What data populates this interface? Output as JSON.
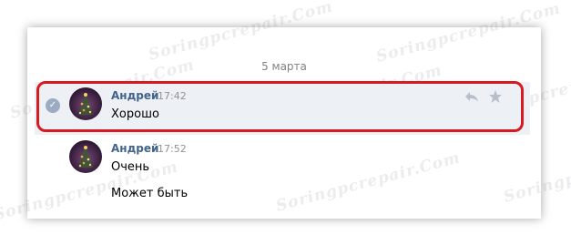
{
  "watermark": {
    "text": "Soringpcrepair.Com"
  },
  "conversation": {
    "date_separator": "5 марта",
    "messages": [
      {
        "author": "Андрей",
        "time": "17:42",
        "lines": [
          "Хорошо"
        ],
        "selected": true
      },
      {
        "author": "Андрей",
        "time": "17:52",
        "lines": [
          "Очень",
          "Может быть"
        ],
        "selected": false
      }
    ]
  },
  "icons": {
    "selected_check": "check-icon",
    "reply": "reply-icon",
    "important": "star-icon"
  },
  "colors": {
    "author_name": "#42648b",
    "selected_background": "#edf0f5",
    "highlight_frame": "#d71920",
    "action_icon": "#b7c0ca"
  }
}
